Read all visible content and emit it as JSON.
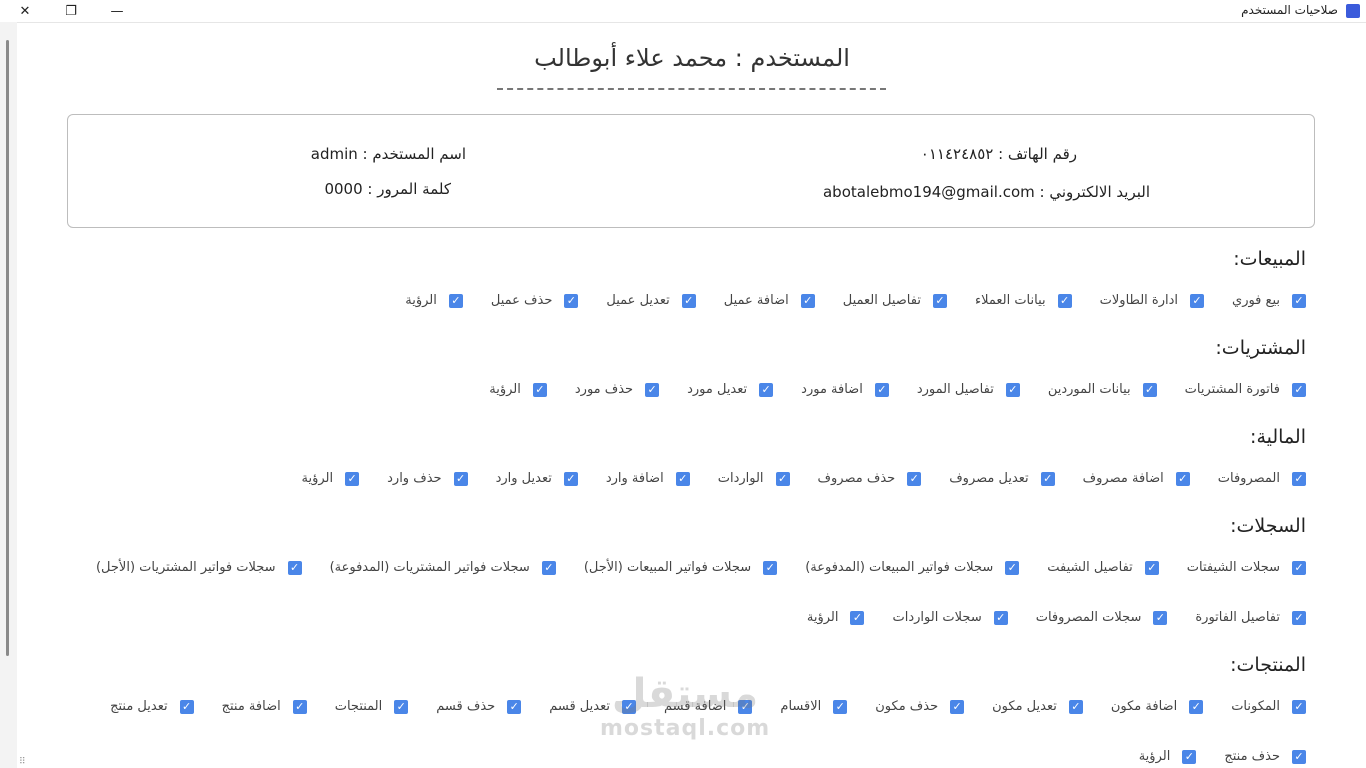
{
  "window": {
    "title": "صلاحيات المستخدم",
    "close_glyph": "✕",
    "restore_glyph": "❐",
    "minimize_glyph": "—"
  },
  "user": {
    "title": "المستخدم : محمد علاء أبوطالب",
    "username": "اسم المستخدم : admin",
    "password": "كلمة المرور : 0000",
    "phone": "رقم الهاتف : ٠١١٤٢٤٨٥٢",
    "email": "البريد الالكتروني : abotalebmo194@gmail.com"
  },
  "sections": {
    "sales": {
      "title": "المبيعات:",
      "items": [
        {
          "label": "بيع فوري",
          "checked": true
        },
        {
          "label": "ادارة الطاولات",
          "checked": true
        },
        {
          "label": "بيانات العملاء",
          "checked": true
        },
        {
          "label": "تفاصيل العميل",
          "checked": true
        },
        {
          "label": "اضافة عميل",
          "checked": true
        },
        {
          "label": "تعديل عميل",
          "checked": true
        },
        {
          "label": "حذف عميل",
          "checked": true
        },
        {
          "label": "الرؤية",
          "checked": true
        }
      ]
    },
    "purchases": {
      "title": "المشتريات:",
      "items": [
        {
          "label": "فاتورة المشتريات",
          "checked": true
        },
        {
          "label": "بيانات الموردين",
          "checked": true
        },
        {
          "label": "تفاصيل المورد",
          "checked": true
        },
        {
          "label": "اضافة مورد",
          "checked": true
        },
        {
          "label": "تعديل مورد",
          "checked": true
        },
        {
          "label": "حذف مورد",
          "checked": true
        },
        {
          "label": "الرؤية",
          "checked": true
        }
      ]
    },
    "finance": {
      "title": "المالية:",
      "items": [
        {
          "label": "المصروفات",
          "checked": true
        },
        {
          "label": "اضافة مصروف",
          "checked": true
        },
        {
          "label": "تعديل مصروف",
          "checked": true
        },
        {
          "label": "حذف مصروف",
          "checked": true
        },
        {
          "label": "الواردات",
          "checked": true
        },
        {
          "label": "اضافة وارد",
          "checked": true
        },
        {
          "label": "تعديل وارد",
          "checked": true
        },
        {
          "label": "حذف وارد",
          "checked": true
        },
        {
          "label": "الرؤية",
          "checked": true
        }
      ]
    },
    "records": {
      "title": "السجلات:",
      "row1": [
        {
          "label": "سجلات الشيفتات",
          "checked": true
        },
        {
          "label": "تفاصيل الشيفت",
          "checked": true
        },
        {
          "label": "سجلات فواتير المبيعات (المدفوعة)",
          "checked": true
        },
        {
          "label": "سجلات فواتير المبيعات (الأجل)",
          "checked": true
        },
        {
          "label": "سجلات فواتير المشتريات (المدفوعة)",
          "checked": true
        },
        {
          "label": "سجلات فواتير المشتريات (الأجل)",
          "checked": true
        }
      ],
      "row2": [
        {
          "label": "تفاصيل الفاتورة",
          "checked": true
        },
        {
          "label": "سجلات المصروفات",
          "checked": true
        },
        {
          "label": "سجلات الواردات",
          "checked": true
        },
        {
          "label": "الرؤية",
          "checked": true
        }
      ]
    },
    "products": {
      "title": "المنتجات:",
      "row1": [
        {
          "label": "المكونات",
          "checked": true
        },
        {
          "label": "اضافة مكون",
          "checked": true
        },
        {
          "label": "تعديل مكون",
          "checked": true
        },
        {
          "label": "حذف مكون",
          "checked": true
        },
        {
          "label": "الاقسام",
          "checked": true
        },
        {
          "label": "اضافة قسم",
          "checked": true
        },
        {
          "label": "تعديل قسم",
          "checked": true
        },
        {
          "label": "حذف قسم",
          "checked": true
        },
        {
          "label": "المنتجات",
          "checked": true
        },
        {
          "label": "اضافة منتج",
          "checked": true
        },
        {
          "label": "تعديل منتج",
          "checked": true
        }
      ],
      "row2": [
        {
          "label": "حذف منتج",
          "checked": true
        },
        {
          "label": "الرؤية",
          "checked": true
        }
      ]
    }
  },
  "watermark": {
    "big": "مستقل",
    "small": "mostaql.com"
  },
  "checkmark_glyph": "✓"
}
